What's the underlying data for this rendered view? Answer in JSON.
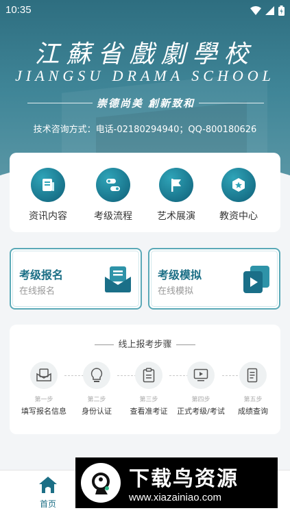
{
  "status_bar": {
    "time": "10:35"
  },
  "header": {
    "school_name_cn": "江蘇省戲劇學校",
    "school_name_en": "JIANGSU DRAMA SCHOOL",
    "motto": "崇德尚美 創新致和",
    "contact": "技术咨询方式：电话-02180294940；QQ-800180626"
  },
  "nav": {
    "items": [
      {
        "label": "资讯内容",
        "icon": "news-icon"
      },
      {
        "label": "考级流程",
        "icon": "flow-icon"
      },
      {
        "label": "艺术展演",
        "icon": "flag-icon"
      },
      {
        "label": "教资中心",
        "icon": "badge-icon"
      }
    ]
  },
  "actions": {
    "register": {
      "title": "考级报名",
      "subtitle": "在线报名",
      "icon": "mail-tray-icon"
    },
    "mock": {
      "title": "考级模拟",
      "subtitle": "在线模拟",
      "icon": "video-stack-icon"
    }
  },
  "steps": {
    "title": "线上报考步骤",
    "items": [
      {
        "num": "第一步",
        "label": "填写报名信息",
        "icon": "envelope-icon"
      },
      {
        "num": "第二步",
        "label": "身份认证",
        "icon": "bulb-icon"
      },
      {
        "num": "第三步",
        "label": "查看准考证",
        "icon": "clipboard-icon"
      },
      {
        "num": "第四步",
        "label": "正式考级/考试",
        "icon": "play-screen-icon"
      },
      {
        "num": "第五步",
        "label": "成绩查询",
        "icon": "document-icon"
      }
    ]
  },
  "tabbar": {
    "home_label": "首页"
  },
  "watermark": {
    "text": "下载鸟资源",
    "url": "www.xiazainiao.com"
  },
  "colors": {
    "primary": "#1c6f86",
    "accent": "#2fa4b8",
    "header": "#3f8597"
  }
}
